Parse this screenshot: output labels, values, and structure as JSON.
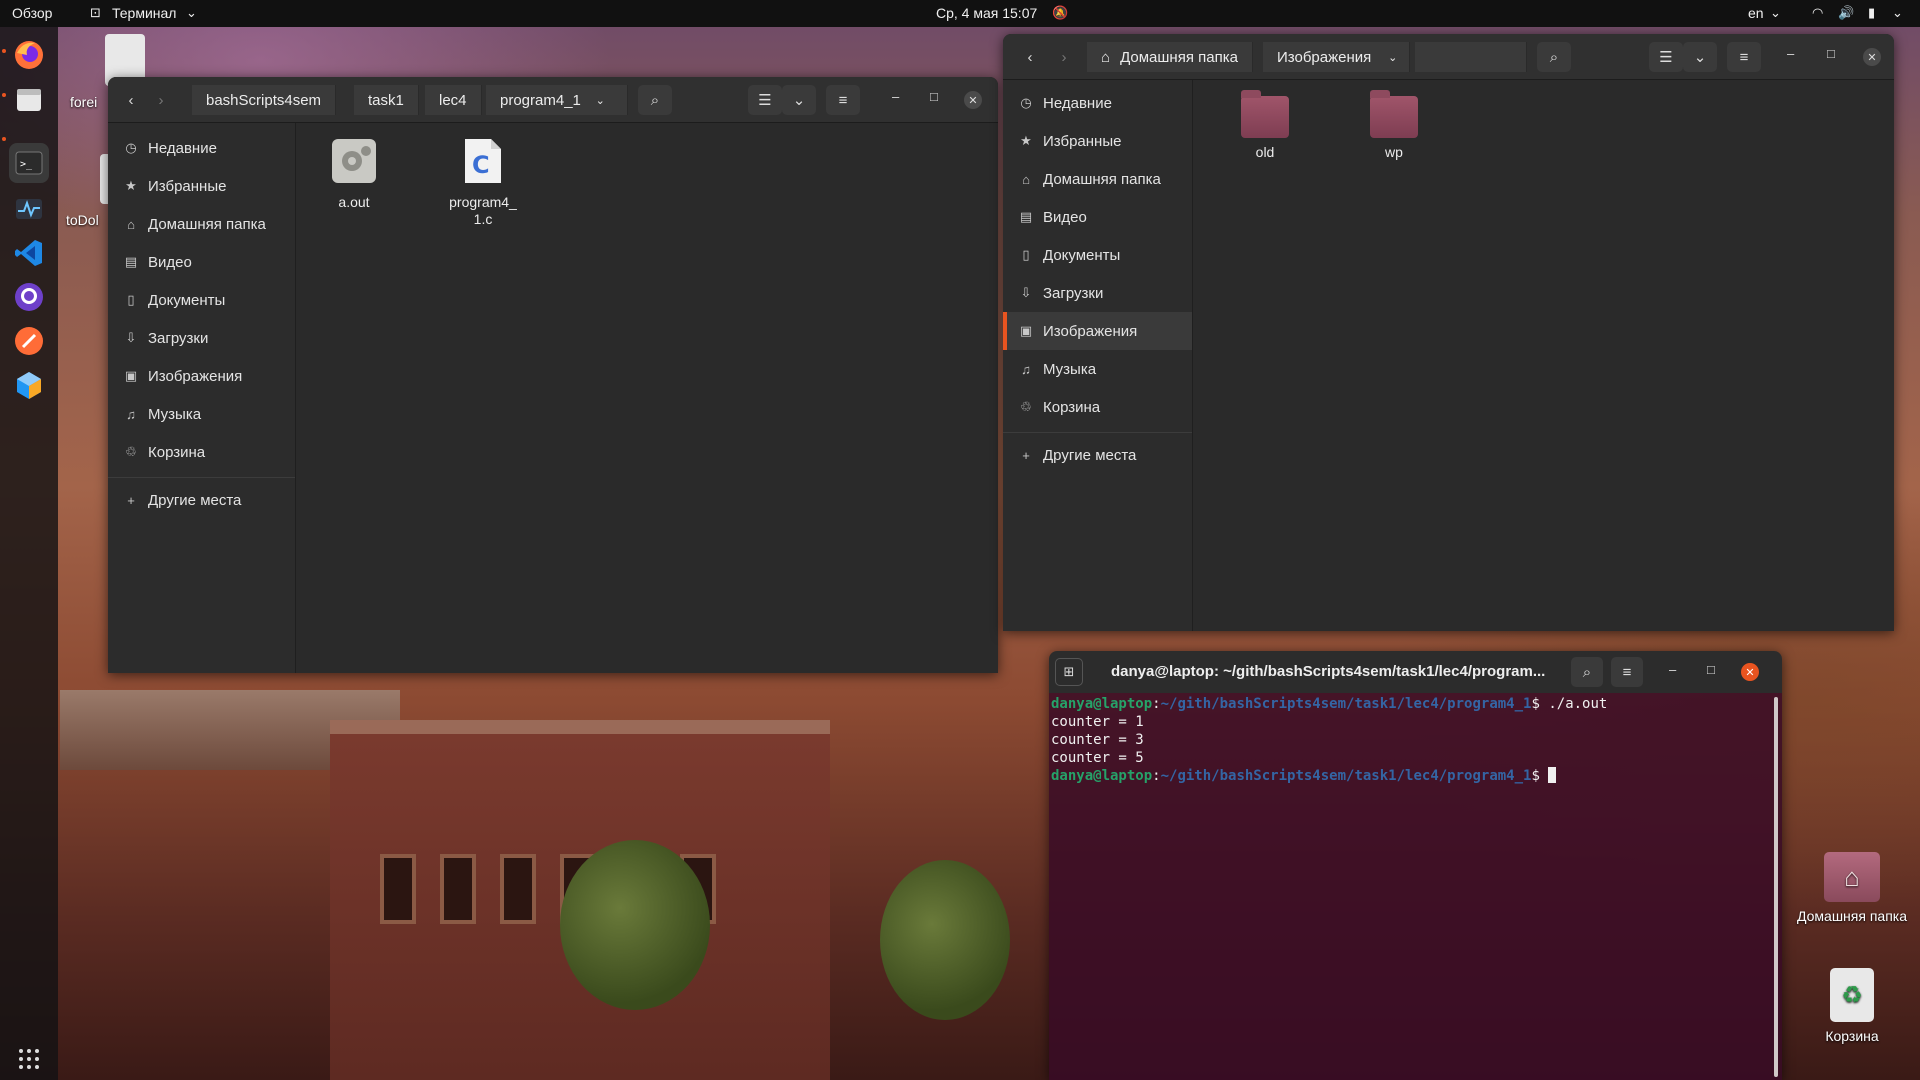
{
  "topbar": {
    "overview": "Обзор",
    "app_menu": "Терминал",
    "clock": "Ср, 4 мая  15:07",
    "keyboard_layout": "en"
  },
  "desktop": {
    "partial_labels": [
      "forei",
      "toDol"
    ],
    "home_label": "Домашняя папка",
    "trash_label": "Корзина"
  },
  "left_window": {
    "crumbs": [
      "bashScripts4sem",
      "task1",
      "lec4",
      "program4_1"
    ],
    "sidebar": [
      {
        "icon": "clock-icon",
        "label": "Недавние"
      },
      {
        "icon": "star-icon",
        "label": "Избранные"
      },
      {
        "icon": "home-icon",
        "label": "Домашняя папка"
      },
      {
        "icon": "film-icon",
        "label": "Видео"
      },
      {
        "icon": "document-icon",
        "label": "Документы"
      },
      {
        "icon": "download-icon",
        "label": "Загрузки"
      },
      {
        "icon": "image-icon",
        "label": "Изображения"
      },
      {
        "icon": "music-icon",
        "label": "Музыка"
      },
      {
        "icon": "trash-icon",
        "label": "Корзина"
      },
      {
        "icon": "plus-icon",
        "label": "Другие места"
      }
    ],
    "files": [
      {
        "name": "a.out",
        "type": "executable"
      },
      {
        "name": "program4_\n1.c",
        "type": "c-source"
      }
    ]
  },
  "right_window": {
    "crumbs": [
      "Домашняя папка",
      "Изображения"
    ],
    "sidebar": [
      {
        "icon": "clock-icon",
        "label": "Недавние"
      },
      {
        "icon": "star-icon",
        "label": "Избранные"
      },
      {
        "icon": "home-icon",
        "label": "Домашняя папка"
      },
      {
        "icon": "film-icon",
        "label": "Видео"
      },
      {
        "icon": "document-icon",
        "label": "Документы"
      },
      {
        "icon": "download-icon",
        "label": "Загрузки"
      },
      {
        "icon": "image-icon",
        "label": "Изображения"
      },
      {
        "icon": "music-icon",
        "label": "Музыка"
      },
      {
        "icon": "trash-icon",
        "label": "Корзина"
      },
      {
        "icon": "plus-icon",
        "label": "Другие места"
      }
    ],
    "active_item": "Изображения",
    "folders": [
      "old",
      "wp"
    ]
  },
  "terminal": {
    "title": "danya@laptop: ~/gith/bashScripts4sem/task1/lec4/program...",
    "prompt_user": "danya@laptop",
    "prompt_path": "~/gith/bashScripts4sem/task1/lec4/program4_1",
    "command": " ./a.out",
    "output": [
      "counter = 1",
      "counter = 3",
      "counter = 5"
    ]
  },
  "colors": {
    "accent": "#e95420",
    "prompt_user": "#26a269",
    "prompt_path": "#3465a4"
  }
}
